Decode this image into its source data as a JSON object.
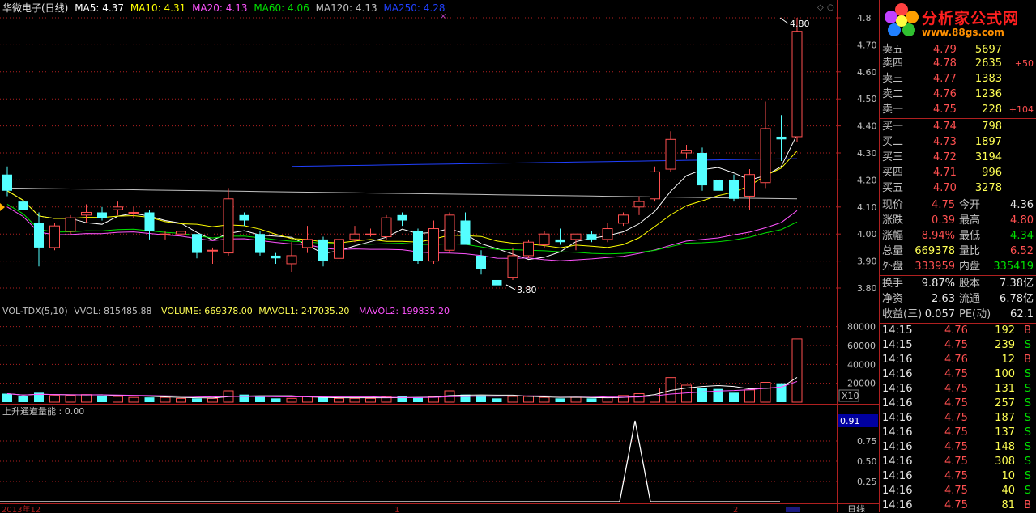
{
  "main_header": {
    "title": "华微电子(日线)",
    "ma5": "MA5: 4.37",
    "ma10": "MA10: 4.31",
    "ma20": "MA20: 4.13",
    "ma60": "MA60: 4.06",
    "ma120": "MA120: 4.13",
    "ma250": "MA250: 4.28"
  },
  "price_axis": [
    "4.8",
    "4.70",
    "4.60",
    "4.50",
    "4.40",
    "4.30",
    "4.20",
    "4.10",
    "4.00",
    "3.90",
    "3.80"
  ],
  "price_annotations": {
    "high": "4.80",
    "low": "3.80"
  },
  "vol_header": {
    "name": "VOL-TDX(5,10)",
    "vvol": "VVOL: 815485.88",
    "volume": "VOLUME: 669378.00",
    "mavol1": "MAVOL1: 247035.20",
    "mavol2": "MAVOL2: 199835.20"
  },
  "vol_axis": [
    "80000",
    "60000",
    "40000",
    "20000"
  ],
  "vol_unit": "X10",
  "ind_header": "上升通道量能 : 0.00",
  "ind_axis": {
    "current": "0.91",
    "ticks": [
      "0.75",
      "0.50",
      "0.25"
    ]
  },
  "date_axis": {
    "start": "2013年12",
    "mid": "1",
    "mid2": "2"
  },
  "period_label": "日线",
  "logo": {
    "brand": "分析家公式网",
    "site": "www.88gs.com"
  },
  "order_book": {
    "asks": [
      {
        "label": "卖五",
        "price": "4.79",
        "vol": "5697",
        "chg": ""
      },
      {
        "label": "卖四",
        "price": "4.78",
        "vol": "2635",
        "chg": "+50"
      },
      {
        "label": "卖三",
        "price": "4.77",
        "vol": "1383",
        "chg": ""
      },
      {
        "label": "卖二",
        "price": "4.76",
        "vol": "1236",
        "chg": ""
      },
      {
        "label": "卖一",
        "price": "4.75",
        "vol": "228",
        "chg": "+104"
      }
    ],
    "bids": [
      {
        "label": "买一",
        "price": "4.74",
        "vol": "798"
      },
      {
        "label": "买二",
        "price": "4.73",
        "vol": "1897"
      },
      {
        "label": "买三",
        "price": "4.72",
        "vol": "3194"
      },
      {
        "label": "买四",
        "price": "4.71",
        "vol": "996"
      },
      {
        "label": "买五",
        "price": "4.70",
        "vol": "3278"
      }
    ]
  },
  "stats": [
    {
      "l1": "现价",
      "v1": "4.75",
      "c1": "red",
      "l2": "今开",
      "v2": "4.36",
      "c2": "white"
    },
    {
      "l1": "涨跌",
      "v1": "0.39",
      "c1": "red",
      "l2": "最高",
      "v2": "4.80",
      "c2": "red"
    },
    {
      "l1": "涨幅",
      "v1": "8.94%",
      "c1": "red",
      "l2": "最低",
      "v2": "4.34",
      "c2": "green"
    },
    {
      "l1": "总量",
      "v1": "669378",
      "c1": "white",
      "l2": "量比",
      "v2": "6.52",
      "c2": "red"
    },
    {
      "l1": "外盘",
      "v1": "333959",
      "c1": "red",
      "l2": "内盘",
      "v2": "335419",
      "c2": "green"
    }
  ],
  "stats2": [
    {
      "l1": "换手",
      "v1": "9.87%",
      "l2": "股本",
      "v2": "7.38亿"
    },
    {
      "l1": "净资",
      "v1": "2.63",
      "l2": "流通",
      "v2": "6.78亿"
    },
    {
      "l1": "收益(三)",
      "v1": "0.057",
      "l2": "PE(动)",
      "v2": "62.1"
    }
  ],
  "ticks": [
    {
      "time": "14:15",
      "price": "4.76",
      "vol": "192",
      "side": "B"
    },
    {
      "time": "14:15",
      "price": "4.75",
      "vol": "239",
      "side": "S"
    },
    {
      "time": "14:16",
      "price": "4.76",
      "vol": "12",
      "side": "B"
    },
    {
      "time": "14:16",
      "price": "4.75",
      "vol": "100",
      "side": "S"
    },
    {
      "time": "14:16",
      "price": "4.75",
      "vol": "131",
      "side": "S"
    },
    {
      "time": "14:16",
      "price": "4.75",
      "vol": "257",
      "side": "S"
    },
    {
      "time": "14:16",
      "price": "4.75",
      "vol": "187",
      "side": "S"
    },
    {
      "time": "14:16",
      "price": "4.75",
      "vol": "137",
      "side": "S"
    },
    {
      "time": "14:16",
      "price": "4.75",
      "vol": "148",
      "side": "S"
    },
    {
      "time": "14:16",
      "price": "4.75",
      "vol": "308",
      "side": "S"
    },
    {
      "time": "14:16",
      "price": "4.75",
      "vol": "10",
      "side": "S"
    },
    {
      "time": "14:16",
      "price": "4.75",
      "vol": "40",
      "side": "S"
    },
    {
      "time": "14:16",
      "price": "4.75",
      "vol": "81",
      "side": "B"
    }
  ],
  "colors": {
    "up": "#ff5050",
    "down": "#54ffff",
    "ma5": "#ffffff",
    "ma10": "#ffff00",
    "ma20": "#ff54ff",
    "ma60": "#00e000",
    "ma120": "#c0c0c0",
    "ma250": "#2040ff",
    "grid": "#b02020"
  },
  "candles": [
    {
      "o": 4.22,
      "h": 4.25,
      "l": 4.14,
      "c": 4.16
    },
    {
      "o": 4.12,
      "h": 4.14,
      "l": 4.04,
      "c": 4.09
    },
    {
      "o": 4.04,
      "h": 4.08,
      "l": 3.88,
      "c": 3.95
    },
    {
      "o": 3.95,
      "h": 4.04,
      "l": 3.94,
      "c": 4.03
    },
    {
      "o": 4.01,
      "h": 4.07,
      "l": 4.0,
      "c": 4.06
    },
    {
      "o": 4.07,
      "h": 4.11,
      "l": 4.04,
      "c": 4.08
    },
    {
      "o": 4.08,
      "h": 4.1,
      "l": 4.05,
      "c": 4.06
    },
    {
      "o": 4.09,
      "h": 4.12,
      "l": 4.07,
      "c": 4.1
    },
    {
      "o": 4.08,
      "h": 4.1,
      "l": 4.06,
      "c": 4.08
    },
    {
      "o": 4.08,
      "h": 4.09,
      "l": 3.98,
      "c": 4.01
    },
    {
      "o": 4.0,
      "h": 4.01,
      "l": 3.98,
      "c": 4.0
    },
    {
      "o": 4.0,
      "h": 4.02,
      "l": 3.99,
      "c": 4.01
    },
    {
      "o": 4.0,
      "h": 4.0,
      "l": 3.91,
      "c": 3.93
    },
    {
      "o": 3.94,
      "h": 3.95,
      "l": 3.89,
      "c": 3.94
    },
    {
      "o": 3.93,
      "h": 4.17,
      "l": 3.92,
      "c": 4.13
    },
    {
      "o": 4.07,
      "h": 4.08,
      "l": 4.03,
      "c": 4.05
    },
    {
      "o": 4.0,
      "h": 4.01,
      "l": 3.92,
      "c": 3.93
    },
    {
      "o": 3.92,
      "h": 3.93,
      "l": 3.89,
      "c": 3.91
    },
    {
      "o": 3.89,
      "h": 3.97,
      "l": 3.86,
      "c": 3.92
    },
    {
      "o": 3.95,
      "h": 4.03,
      "l": 3.93,
      "c": 3.98
    },
    {
      "o": 3.98,
      "h": 3.99,
      "l": 3.88,
      "c": 3.9
    },
    {
      "o": 3.91,
      "h": 4.0,
      "l": 3.9,
      "c": 3.98
    },
    {
      "o": 3.98,
      "h": 4.03,
      "l": 3.97,
      "c": 4.0
    },
    {
      "o": 4.0,
      "h": 4.02,
      "l": 3.99,
      "c": 4.0
    },
    {
      "o": 3.99,
      "h": 4.07,
      "l": 3.98,
      "c": 4.06
    },
    {
      "o": 4.07,
      "h": 4.08,
      "l": 4.03,
      "c": 4.05
    },
    {
      "o": 4.01,
      "h": 4.02,
      "l": 3.89,
      "c": 3.9
    },
    {
      "o": 3.9,
      "h": 4.05,
      "l": 3.89,
      "c": 4.02
    },
    {
      "o": 3.94,
      "h": 4.08,
      "l": 3.93,
      "c": 4.07
    },
    {
      "o": 4.05,
      "h": 4.08,
      "l": 3.96,
      "c": 3.96
    },
    {
      "o": 3.92,
      "h": 3.94,
      "l": 3.85,
      "c": 3.87
    },
    {
      "o": 3.83,
      "h": 3.84,
      "l": 3.8,
      "c": 3.81
    },
    {
      "o": 3.84,
      "h": 3.95,
      "l": 3.83,
      "c": 3.92
    },
    {
      "o": 3.92,
      "h": 3.98,
      "l": 3.91,
      "c": 3.97
    },
    {
      "o": 3.96,
      "h": 4.01,
      "l": 3.95,
      "c": 4.0
    },
    {
      "o": 3.98,
      "h": 4.02,
      "l": 3.96,
      "c": 3.97
    },
    {
      "o": 3.98,
      "h": 4.0,
      "l": 3.94,
      "c": 4.0
    },
    {
      "o": 4.0,
      "h": 4.01,
      "l": 3.97,
      "c": 3.98
    },
    {
      "o": 3.98,
      "h": 4.04,
      "l": 3.97,
      "c": 4.02
    },
    {
      "o": 4.04,
      "h": 4.08,
      "l": 4.03,
      "c": 4.07
    },
    {
      "o": 4.1,
      "h": 4.14,
      "l": 4.07,
      "c": 4.12
    },
    {
      "o": 4.13,
      "h": 4.25,
      "l": 4.12,
      "c": 4.23
    },
    {
      "o": 4.24,
      "h": 4.38,
      "l": 4.23,
      "c": 4.35
    },
    {
      "o": 4.3,
      "h": 4.33,
      "l": 4.28,
      "c": 4.31
    },
    {
      "o": 4.3,
      "h": 4.32,
      "l": 4.16,
      "c": 4.18
    },
    {
      "o": 4.2,
      "h": 4.24,
      "l": 4.15,
      "c": 4.16
    },
    {
      "o": 4.2,
      "h": 4.22,
      "l": 4.12,
      "c": 4.13
    },
    {
      "o": 4.14,
      "h": 4.24,
      "l": 4.09,
      "c": 4.22
    },
    {
      "o": 4.19,
      "h": 4.49,
      "l": 4.17,
      "c": 4.39
    },
    {
      "o": 4.36,
      "h": 4.44,
      "l": 4.27,
      "c": 4.35
    },
    {
      "o": 4.36,
      "h": 4.8,
      "l": 4.34,
      "c": 4.75
    }
  ],
  "volumes": [
    9000,
    6000,
    10000,
    7000,
    7000,
    8000,
    7000,
    6000,
    5000,
    5000,
    5000,
    4000,
    4000,
    4000,
    12000,
    8000,
    6000,
    4000,
    4000,
    6000,
    5000,
    4000,
    4000,
    4000,
    6000,
    6000,
    5000,
    6000,
    12000,
    8000,
    7000,
    4000,
    6000,
    6000,
    5000,
    4000,
    5000,
    4000,
    5000,
    7000,
    9000,
    15000,
    26000,
    18000,
    15000,
    14000,
    10000,
    13000,
    21000,
    20000,
    66938
  ]
}
